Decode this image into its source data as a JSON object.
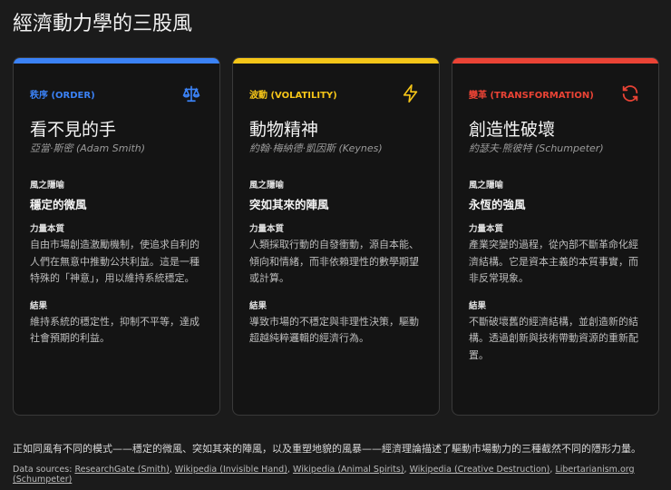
{
  "title": "經濟動力學的三股風",
  "cards": [
    {
      "label": "秩序 (ORDER)",
      "icon": "scale-icon",
      "color": "#3b82f6",
      "title": "看不見的手",
      "author": "亞當·斯密 (Adam Smith)",
      "metaphor_label": "風之隱喻",
      "metaphor": "穩定的微風",
      "nature_label": "力量本質",
      "nature": "自由市場創造激勵機制，使追求自利的人們在無意中推動公共利益。這是一種特殊的「神意」，用以維持系統穩定。",
      "result_label": "結果",
      "result": "維持系統的穩定性，抑制不平等，達成社會預期的利益。"
    },
    {
      "label": "波動 (VOLATILITY)",
      "icon": "lightning-icon",
      "color": "#f5c518",
      "title": "動物精神",
      "author": "約翰·梅納德·凱因斯 (Keynes)",
      "metaphor_label": "風之隱喻",
      "metaphor": "突如其來的陣風",
      "nature_label": "力量本質",
      "nature": "人類採取行動的自發衝動，源自本能、傾向和情緒，而非依賴理性的數學期望或計算。",
      "result_label": "結果",
      "result": "導致市場的不穩定與非理性決策，驅動超越純粹邏輯的經濟行為。"
    },
    {
      "label": "變革 (TRANSFORMATION)",
      "icon": "refresh-icon",
      "color": "#ea4335",
      "title": "創造性破壞",
      "author": "約瑟夫·熊彼特 (Schumpeter)",
      "metaphor_label": "風之隱喻",
      "metaphor": "永恆的強風",
      "nature_label": "力量本質",
      "nature": "產業突變的過程，從內部不斷革命化經濟結構。它是資本主義的本質事實，而非反常現象。",
      "result_label": "結果",
      "result": "不斷破壞舊的經濟結構，並創造新的結構。透過創新與技術帶動資源的重新配置。"
    }
  ],
  "footer": "正如同風有不同的模式——穩定的微風、突如其來的陣風，以及重塑地貌的風暴——經濟理論描述了驅動市場動力的三種截然不同的隱形力量。",
  "sources_label": "Data sources:",
  "sources": [
    "ResearchGate (Smith)",
    "Wikipedia (Invisible Hand)",
    "Wikipedia (Animal Spirits)",
    "Wikipedia (Creative Destruction)",
    "Libertarianism.org (Schumpeter)"
  ]
}
